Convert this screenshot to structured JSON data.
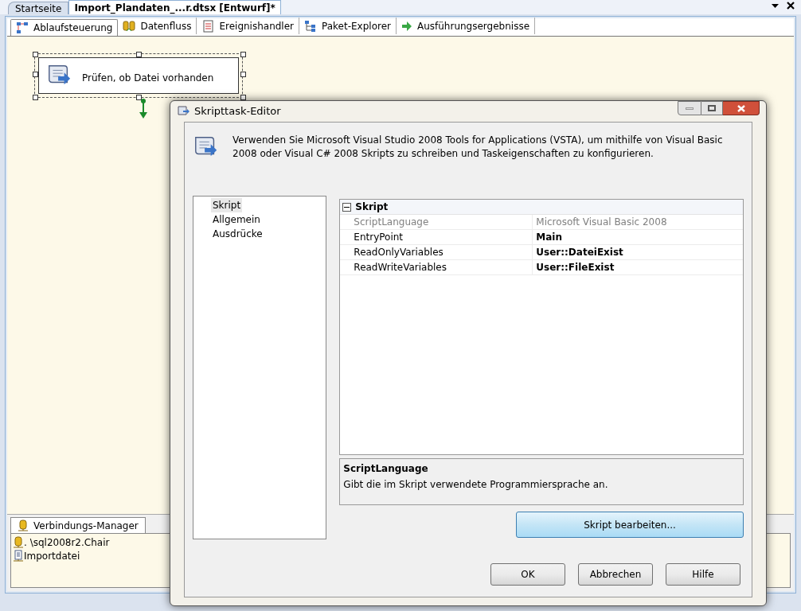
{
  "document_tabs": [
    {
      "label": "Startseite",
      "selected": false
    },
    {
      "label": "Import_Plandaten_...r.dtsx [Entwurf]*",
      "selected": true
    }
  ],
  "designer_tabs": [
    {
      "label": "Ablaufsteuerung",
      "selected": true
    },
    {
      "label": "Datenfluss",
      "selected": false
    },
    {
      "label": "Ereignishandler",
      "selected": false
    },
    {
      "label": "Paket-Explorer",
      "selected": false
    },
    {
      "label": "Ausführungsergebnisse",
      "selected": false
    }
  ],
  "task": {
    "label": "Prüfen, ob Datei vorhanden",
    "selected": true
  },
  "connection_manager": {
    "tab": "Verbindungs-Manager",
    "items": [
      {
        "label": ". \\sql2008r2.Chair",
        "kind": "database"
      },
      {
        "label": "Importdatei",
        "kind": "file"
      }
    ]
  },
  "dialog": {
    "title": "Skripttask-Editor",
    "description": "Verwenden Sie Microsoft Visual Studio 2008 Tools for Applications (VSTA), um mithilfe von Visual Basic 2008 oder Visual C# 2008 Skripts zu schreiben und Taskeigenschaften zu konfigurieren.",
    "pages": [
      {
        "label": "Skript",
        "selected": true
      },
      {
        "label": "Allgemein",
        "selected": false
      },
      {
        "label": "Ausdrücke",
        "selected": false
      }
    ],
    "property_grid": {
      "category": "Skript",
      "expanded": true,
      "rows": [
        {
          "name": "ScriptLanguage",
          "value": "Microsoft Visual Basic 2008",
          "disabled": true
        },
        {
          "name": "EntryPoint",
          "value": "Main",
          "disabled": false
        },
        {
          "name": "ReadOnlyVariables",
          "value": "User::DateiExist",
          "disabled": false
        },
        {
          "name": "ReadWriteVariables",
          "value": "User::FileExist",
          "disabled": false
        }
      ]
    },
    "help": {
      "title": "ScriptLanguage",
      "text": "Gibt die im Skript verwendete Programmiersprache an."
    },
    "edit_button": "Skript bearbeiten...",
    "buttons": [
      "OK",
      "Abbrechen",
      "Hilfe"
    ]
  }
}
